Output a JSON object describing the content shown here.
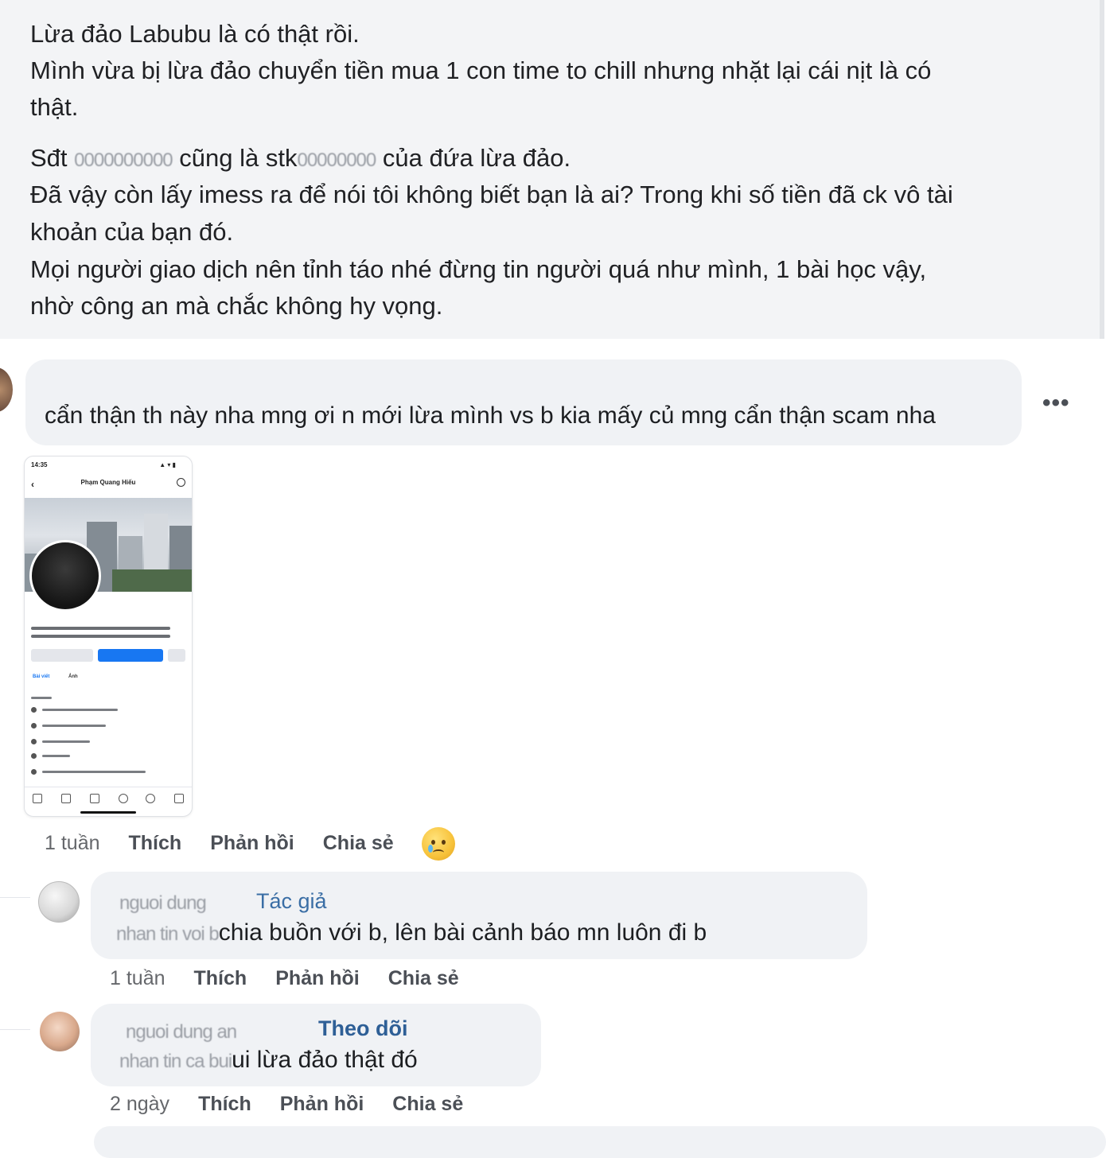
{
  "post": {
    "line1": "Lừa đảo Labubu là có thật rồi.",
    "line2": "Mình vừa bị lừa đảo chuyển tiền mua 1 con time to chill nhưng nhặt lại cái nịt là có",
    "line3": "thật.",
    "line4_a": "Sđt",
    "line4_blur1": "0000000000",
    "line4_b": "cũng là stk",
    "line4_blur2": "00000000",
    "line4_c": "của đứa lừa đảo.",
    "line5": "Đã vậy còn lấy imess ra để nói tôi không biết bạn là ai? Trong khi số tiền đã ck vô tài",
    "line6": "khoản của bạn đó.",
    "line7": "Mọi người giao dịch nên tỉnh táo nhé đừng tin người quá như mình, 1 bài học vậy,",
    "line8": "nhờ công an mà chắc không hy vọng."
  },
  "comment1": {
    "text": "cẩn thận th này nha mng ơi n mới lừa mình vs b kia mấy củ mng cẩn thận scam nha",
    "more": "•••",
    "time": "1 tuần",
    "like": "Thích",
    "reply": "Phản hồi",
    "share": "Chia sẻ",
    "reaction_icon": "crying-face-icon",
    "screenshot": {
      "status_time": "14:35",
      "status_icons": "▲ ▾ ▮",
      "profile_name": "Phạm Quang Hiếu",
      "back": "‹",
      "tab_posts": "Bài viết",
      "tab_photos": "Ảnh"
    }
  },
  "reply1": {
    "name": "nguoi dung",
    "badge": "Tác giả",
    "prefix_blurred": "nhan tin voi b",
    "text": "chia buồn với b, lên bài cảnh báo mn luôn đi b",
    "time": "1 tuần",
    "like": "Thích",
    "reply": "Phản hồi",
    "share": "Chia sẻ"
  },
  "reply2": {
    "name": "nguoi dung an",
    "badge": "Theo dõi",
    "prefix_blurred": "nhan tin ca bui",
    "text": "ui lừa đảo thật đó",
    "time": "2 ngày",
    "like": "Thích",
    "reply": "Phản hồi",
    "share": "Chia sẻ"
  }
}
